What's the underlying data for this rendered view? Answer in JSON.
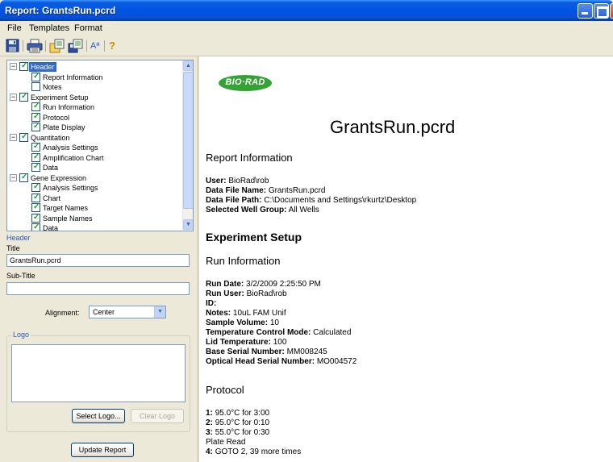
{
  "window": {
    "title": "Report: GrantsRun.pcrd"
  },
  "menu": {
    "file": "File",
    "templates": "Templates",
    "format": "Format"
  },
  "toolbar": {
    "icons": [
      "save-icon",
      "print-icon",
      "open-template-icon",
      "save-template-icon",
      "font-icon",
      "help-icon"
    ],
    "font_label": "Aª",
    "help_label": "?"
  },
  "tree": {
    "items": [
      {
        "label": "Header",
        "level": 0,
        "expander": "−",
        "checked": true,
        "selected": true
      },
      {
        "label": "Report Information",
        "level": 1,
        "checked": true
      },
      {
        "label": "Notes",
        "level": 1,
        "checked": false
      },
      {
        "label": "Experiment Setup",
        "level": 0,
        "expander": "−",
        "checked": true
      },
      {
        "label": "Run Information",
        "level": 1,
        "checked": true
      },
      {
        "label": "Protocol",
        "level": 1,
        "checked": true
      },
      {
        "label": "Plate Display",
        "level": 1,
        "checked": true
      },
      {
        "label": "Quantitation",
        "level": 0,
        "expander": "−",
        "checked": true
      },
      {
        "label": "Analysis Settings",
        "level": 1,
        "checked": true
      },
      {
        "label": "Amplification Chart",
        "level": 1,
        "checked": true
      },
      {
        "label": "Data",
        "level": 1,
        "checked": true
      },
      {
        "label": "Gene Expression",
        "level": 0,
        "expander": "−",
        "checked": true
      },
      {
        "label": "Analysis Settings",
        "level": 1,
        "checked": true
      },
      {
        "label": "Chart",
        "level": 1,
        "checked": true
      },
      {
        "label": "Target Names",
        "level": 1,
        "checked": true
      },
      {
        "label": "Sample Names",
        "level": 1,
        "checked": true
      },
      {
        "label": "Data",
        "level": 1,
        "checked": true
      }
    ]
  },
  "header_panel": {
    "section_label": "Header",
    "title_label": "Title",
    "title_value": "GrantsRun.pcrd",
    "subtitle_label": "Sub-Title",
    "subtitle_value": "",
    "alignment_label": "Alignment:",
    "alignment_value": "Center",
    "logo_label": "Logo",
    "select_logo": "Select Logo...",
    "clear_logo": "Clear Logo",
    "update_report": "Update Report"
  },
  "report": {
    "logo_text": "BIO·RAD",
    "title": "GrantsRun.pcrd",
    "report_info": {
      "heading": "Report Information",
      "user_label": "User:",
      "user_value": "BioRad\\rob",
      "file_name_label": "Data File Name:",
      "file_name_value": "GrantsRun.pcrd",
      "file_path_label": "Data File Path:",
      "file_path_value": "C:\\Documents and Settings\\rkurtz\\Desktop",
      "well_group_label": "Selected Well Group:",
      "well_group_value": "All Wells"
    },
    "experiment_setup": {
      "heading": "Experiment Setup"
    },
    "run_info": {
      "heading": "Run Information",
      "run_date_label": "Run Date:",
      "run_date_value": "3/2/2009 2:25:50 PM",
      "run_user_label": "Run User:",
      "run_user_value": "BioRad\\rob",
      "id_label": "ID:",
      "notes_label": "Notes:",
      "notes_value": "10uL FAM Unif",
      "sample_volume_label": "Sample Volume:",
      "sample_volume_value": "10",
      "temp_mode_label": "Temperature Control Mode:",
      "temp_mode_value": "Calculated",
      "lid_temp_label": "Lid Temperature:",
      "lid_temp_value": "100",
      "base_serial_label": "Base Serial Number:",
      "base_serial_value": "MM008245",
      "optical_serial_label": "Optical Head Serial Number:",
      "optical_serial_value": "MO004572"
    },
    "protocol": {
      "heading": "Protocol",
      "step1_label": "1:",
      "step1_value": "95.0°C for 3:00",
      "step2_label": "2:",
      "step2_value": "95.0°C for 0:10",
      "step3_label": "3:",
      "step3_value": "55.0°C for 0:30",
      "plate_read": "Plate Read",
      "step4_label": "4:",
      "step4_value": "GOTO 2, 39 more times"
    }
  }
}
